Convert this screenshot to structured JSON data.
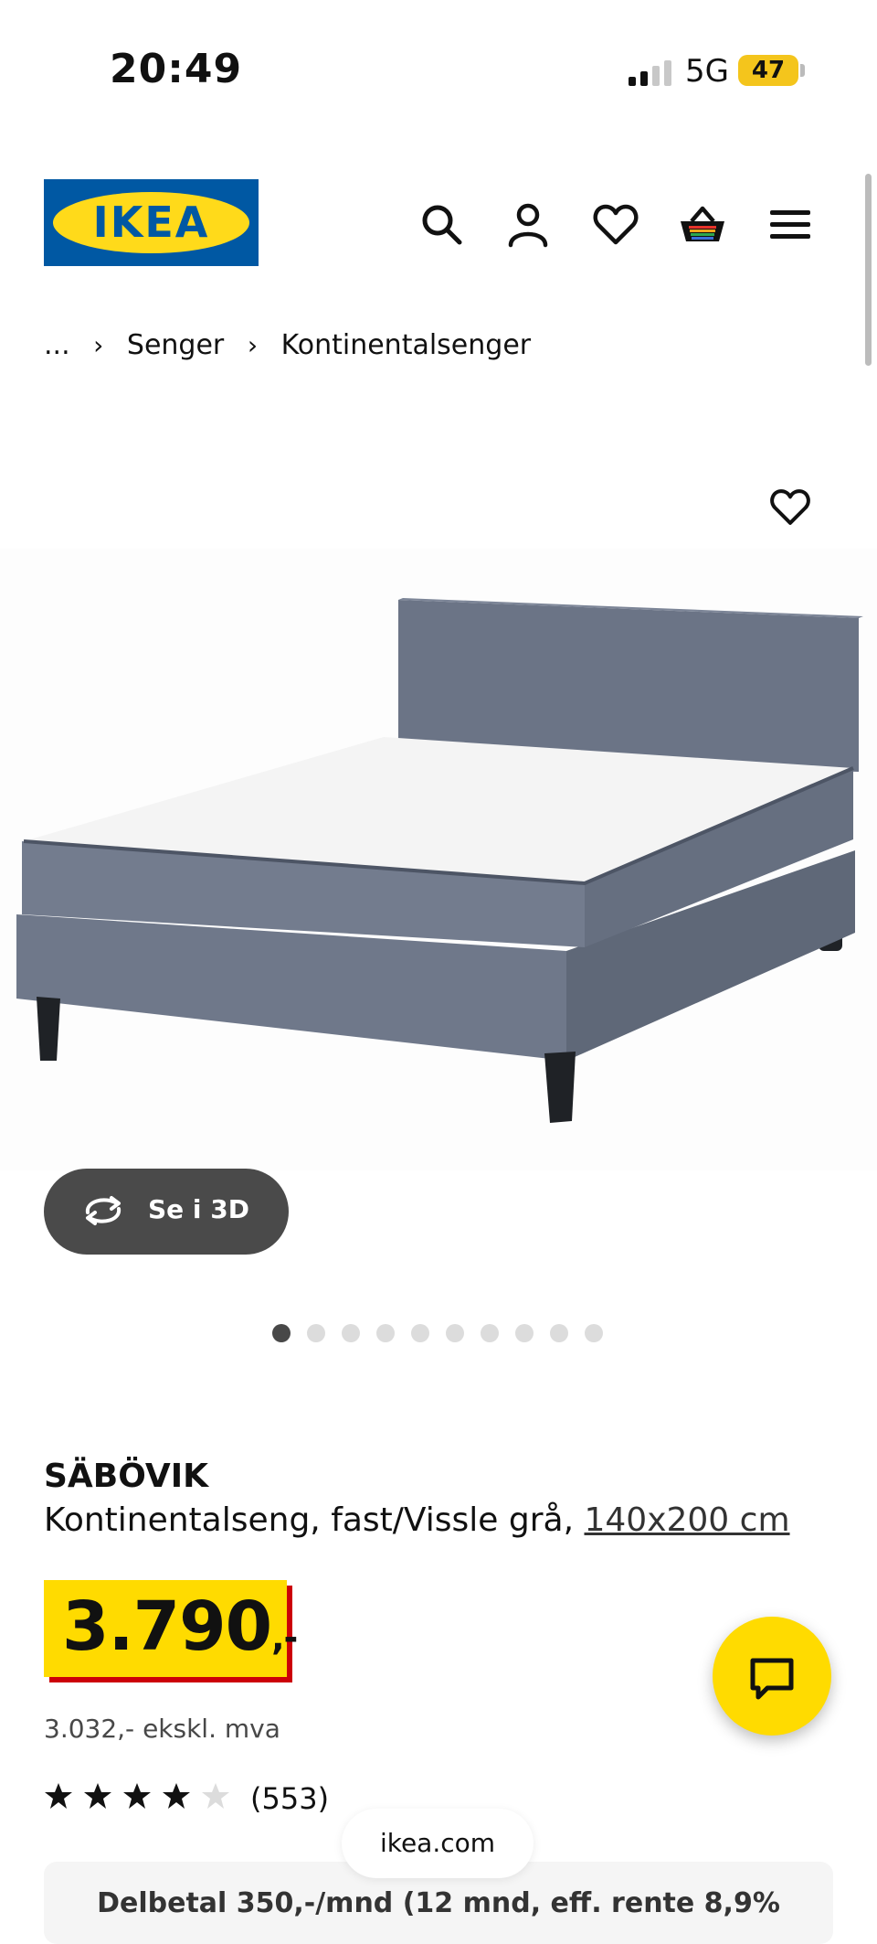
{
  "status_bar": {
    "time": "20:49",
    "network": "5G",
    "battery": "47"
  },
  "header": {
    "logo_text": "IKEA",
    "colors": {
      "brand_blue": "#0058a3",
      "brand_yellow": "#ffda1a"
    },
    "icons": [
      "search-icon",
      "account-icon",
      "heart-icon",
      "basket-icon",
      "menu-icon"
    ]
  },
  "breadcrumb": {
    "ellipsis": "...",
    "items": [
      "Senger",
      "Kontinentalsenger"
    ]
  },
  "gallery": {
    "view_3d_label": "Se i 3D",
    "image_count": 10,
    "active_index": 0
  },
  "product": {
    "name": "SÄBÖVIK",
    "description": "Kontinentalseng, fast/Vissle grå,",
    "size": "140x200 cm",
    "price_main": "3.790",
    "price_suffix": ",-",
    "price_excl_vat": "3.032,- ekskl. mva",
    "rating": 4,
    "rating_max": 5,
    "review_count": "(553)",
    "price_colors": {
      "tag_yellow": "#ffdb00",
      "shadow_red": "#cc0008"
    }
  },
  "browser": {
    "url": "ikea.com"
  },
  "finance_banner": {
    "text": "Delbetal 350,-/mnd (12 mnd, eff. rente 8,9%"
  }
}
